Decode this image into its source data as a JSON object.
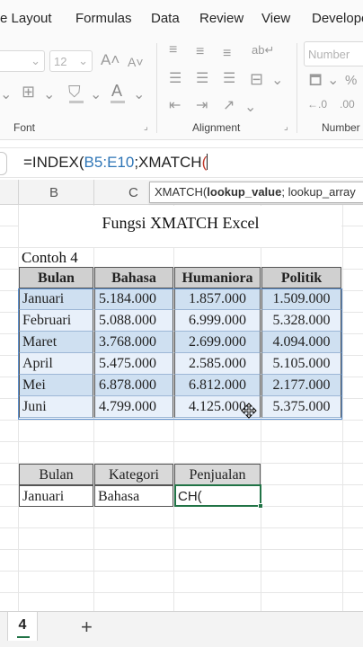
{
  "ribbon_tabs": [
    "e Layout",
    "Formulas",
    "Data",
    "Review",
    "View",
    "Develope"
  ],
  "ribbon": {
    "font_size": "12",
    "number_format": "Number",
    "groups": [
      "Font",
      "Alignment",
      "Number"
    ]
  },
  "formula_bar": {
    "prefix": "=INDEX(",
    "ref": "B5:E10",
    "fn": ";XMATCH",
    "paren": "("
  },
  "columns": [
    "B",
    "C"
  ],
  "tooltip": {
    "fn": "XMATCH(",
    "arg1": "lookup_value",
    "rest": "; lookup_array"
  },
  "sheet": {
    "title": "Fungsi XMATCH Excel",
    "example": "Contoh 4",
    "headers": [
      "Bulan",
      "Bahasa",
      "Humaniora",
      "Politik"
    ],
    "rows": [
      [
        "Januari",
        "5.184.000",
        "1.857.000",
        "1.509.000"
      ],
      [
        "Februari",
        "5.088.000",
        "6.999.000",
        "5.328.000"
      ],
      [
        "Maret",
        "3.768.000",
        "2.699.000",
        "4.094.000"
      ],
      [
        "April",
        "5.475.000",
        "2.585.000",
        "5.105.000"
      ],
      [
        "Mei",
        "6.878.000",
        "6.812.000",
        "2.177.000"
      ],
      [
        "Juni",
        "4.799.000",
        "4.125.000",
        "5.375.000"
      ]
    ],
    "lookup_headers": [
      "Bulan",
      "Kategori",
      "Penjualan"
    ],
    "lookup_values": [
      "Januari",
      "Bahasa",
      "CH("
    ]
  },
  "sheet_tab": "4",
  "add_sheet": "+"
}
